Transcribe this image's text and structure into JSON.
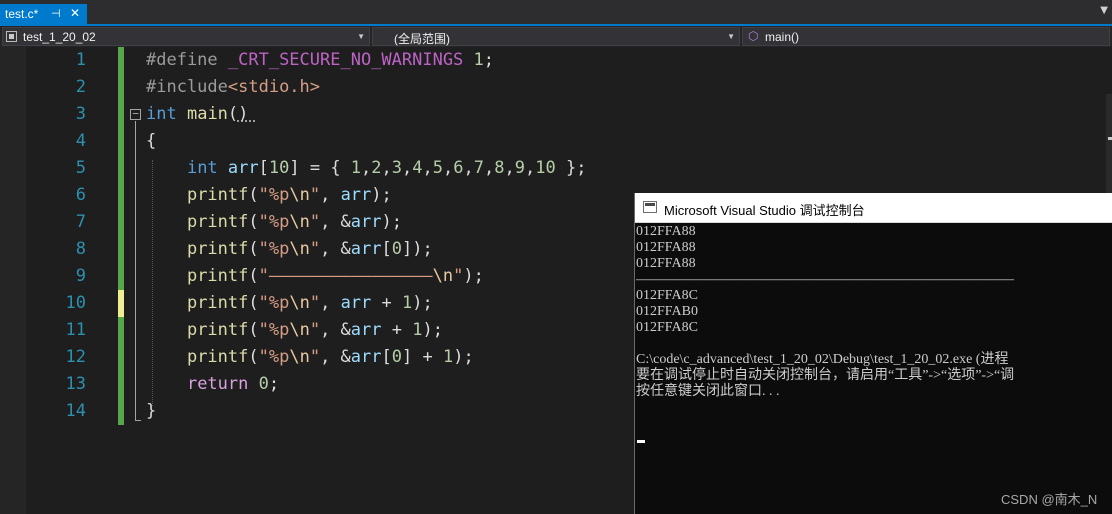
{
  "tab": {
    "title": "test.c*",
    "pin_icon": "⊣",
    "close_icon": "✕"
  },
  "navbar": {
    "project": "test_1_20_02",
    "scope": "(全局范围)",
    "function": "main()"
  },
  "editor": {
    "lines": [
      {
        "number": "1",
        "tokens": [
          {
            "t": "#define ",
            "c": "t-pre"
          },
          {
            "t": "_CRT_SECURE_NO_WARNINGS",
            "c": "t-macro"
          },
          {
            "t": " ",
            "c": "t-plain"
          },
          {
            "t": "1",
            "c": "t-num"
          },
          {
            "t": ";",
            "c": "t-plain"
          }
        ]
      },
      {
        "number": "2",
        "tokens": [
          {
            "t": "#include",
            "c": "t-pre"
          },
          {
            "t": "<stdio.h>",
            "c": "t-str"
          }
        ]
      },
      {
        "number": "3",
        "tokens": [
          {
            "t": "int",
            "c": "t-kw"
          },
          {
            "t": " ",
            "c": "t-plain"
          },
          {
            "t": "main",
            "c": "t-fn"
          },
          {
            "t": "()",
            "c": "t-plain"
          }
        ]
      },
      {
        "number": "4",
        "tokens": [
          {
            "t": "{",
            "c": "t-plain"
          }
        ]
      },
      {
        "number": "5",
        "tokens": [
          {
            "t": "    ",
            "c": "t-plain"
          },
          {
            "t": "int",
            "c": "t-kw"
          },
          {
            "t": " ",
            "c": "t-plain"
          },
          {
            "t": "arr",
            "c": "t-var"
          },
          {
            "t": "[",
            "c": "t-plain"
          },
          {
            "t": "10",
            "c": "t-num"
          },
          {
            "t": "] = { ",
            "c": "t-plain"
          },
          {
            "t": "1",
            "c": "t-num"
          },
          {
            "t": ",",
            "c": "t-plain"
          },
          {
            "t": "2",
            "c": "t-num"
          },
          {
            "t": ",",
            "c": "t-plain"
          },
          {
            "t": "3",
            "c": "t-num"
          },
          {
            "t": ",",
            "c": "t-plain"
          },
          {
            "t": "4",
            "c": "t-num"
          },
          {
            "t": ",",
            "c": "t-plain"
          },
          {
            "t": "5",
            "c": "t-num"
          },
          {
            "t": ",",
            "c": "t-plain"
          },
          {
            "t": "6",
            "c": "t-num"
          },
          {
            "t": ",",
            "c": "t-plain"
          },
          {
            "t": "7",
            "c": "t-num"
          },
          {
            "t": ",",
            "c": "t-plain"
          },
          {
            "t": "8",
            "c": "t-num"
          },
          {
            "t": ",",
            "c": "t-plain"
          },
          {
            "t": "9",
            "c": "t-num"
          },
          {
            "t": ",",
            "c": "t-plain"
          },
          {
            "t": "10",
            "c": "t-num"
          },
          {
            "t": " };",
            "c": "t-plain"
          }
        ]
      },
      {
        "number": "6",
        "tokens": [
          {
            "t": "    ",
            "c": "t-plain"
          },
          {
            "t": "printf",
            "c": "t-fn"
          },
          {
            "t": "(",
            "c": "t-plain"
          },
          {
            "t": "\"%p",
            "c": "t-str"
          },
          {
            "t": "\\n",
            "c": "t-esc"
          },
          {
            "t": "\"",
            "c": "t-str"
          },
          {
            "t": ", ",
            "c": "t-plain"
          },
          {
            "t": "arr",
            "c": "t-var"
          },
          {
            "t": ");",
            "c": "t-plain"
          }
        ]
      },
      {
        "number": "7",
        "tokens": [
          {
            "t": "    ",
            "c": "t-plain"
          },
          {
            "t": "printf",
            "c": "t-fn"
          },
          {
            "t": "(",
            "c": "t-plain"
          },
          {
            "t": "\"%p",
            "c": "t-str"
          },
          {
            "t": "\\n",
            "c": "t-esc"
          },
          {
            "t": "\"",
            "c": "t-str"
          },
          {
            "t": ", &",
            "c": "t-plain"
          },
          {
            "t": "arr",
            "c": "t-var"
          },
          {
            "t": ");",
            "c": "t-plain"
          }
        ]
      },
      {
        "number": "8",
        "tokens": [
          {
            "t": "    ",
            "c": "t-plain"
          },
          {
            "t": "printf",
            "c": "t-fn"
          },
          {
            "t": "(",
            "c": "t-plain"
          },
          {
            "t": "\"%p",
            "c": "t-str"
          },
          {
            "t": "\\n",
            "c": "t-esc"
          },
          {
            "t": "\"",
            "c": "t-str"
          },
          {
            "t": ", &",
            "c": "t-plain"
          },
          {
            "t": "arr",
            "c": "t-var"
          },
          {
            "t": "[",
            "c": "t-plain"
          },
          {
            "t": "0",
            "c": "t-num"
          },
          {
            "t": "]);",
            "c": "t-plain"
          }
        ]
      },
      {
        "number": "9",
        "tokens": [
          {
            "t": "    ",
            "c": "t-plain"
          },
          {
            "t": "printf",
            "c": "t-fn"
          },
          {
            "t": "(",
            "c": "t-plain"
          },
          {
            "t": "\"————————————————",
            "c": "t-str"
          },
          {
            "t": "\\n",
            "c": "t-esc"
          },
          {
            "t": "\"",
            "c": "t-str"
          },
          {
            "t": ");",
            "c": "t-plain"
          }
        ]
      },
      {
        "number": "10",
        "tokens": [
          {
            "t": "    ",
            "c": "t-plain"
          },
          {
            "t": "printf",
            "c": "t-fn"
          },
          {
            "t": "(",
            "c": "t-plain"
          },
          {
            "t": "\"%p",
            "c": "t-str"
          },
          {
            "t": "\\n",
            "c": "t-esc"
          },
          {
            "t": "\"",
            "c": "t-str"
          },
          {
            "t": ", ",
            "c": "t-plain"
          },
          {
            "t": "arr",
            "c": "t-var"
          },
          {
            "t": " + ",
            "c": "t-plain"
          },
          {
            "t": "1",
            "c": "t-num"
          },
          {
            "t": ");",
            "c": "t-plain"
          }
        ]
      },
      {
        "number": "11",
        "tokens": [
          {
            "t": "    ",
            "c": "t-plain"
          },
          {
            "t": "printf",
            "c": "t-fn"
          },
          {
            "t": "(",
            "c": "t-plain"
          },
          {
            "t": "\"%p",
            "c": "t-str"
          },
          {
            "t": "\\n",
            "c": "t-esc"
          },
          {
            "t": "\"",
            "c": "t-str"
          },
          {
            "t": ", &",
            "c": "t-plain"
          },
          {
            "t": "arr",
            "c": "t-var"
          },
          {
            "t": " + ",
            "c": "t-plain"
          },
          {
            "t": "1",
            "c": "t-num"
          },
          {
            "t": ");",
            "c": "t-plain"
          }
        ]
      },
      {
        "number": "12",
        "tokens": [
          {
            "t": "    ",
            "c": "t-plain"
          },
          {
            "t": "printf",
            "c": "t-fn"
          },
          {
            "t": "(",
            "c": "t-plain"
          },
          {
            "t": "\"%p",
            "c": "t-str"
          },
          {
            "t": "\\n",
            "c": "t-esc"
          },
          {
            "t": "\"",
            "c": "t-str"
          },
          {
            "t": ", &",
            "c": "t-plain"
          },
          {
            "t": "arr",
            "c": "t-var"
          },
          {
            "t": "[",
            "c": "t-plain"
          },
          {
            "t": "0",
            "c": "t-num"
          },
          {
            "t": "] + ",
            "c": "t-plain"
          },
          {
            "t": "1",
            "c": "t-num"
          },
          {
            "t": ");",
            "c": "t-plain"
          }
        ]
      },
      {
        "number": "13",
        "tokens": [
          {
            "t": "    ",
            "c": "t-plain"
          },
          {
            "t": "return",
            "c": "t-ctl"
          },
          {
            "t": " ",
            "c": "t-plain"
          },
          {
            "t": "0",
            "c": "t-num"
          },
          {
            "t": ";",
            "c": "t-plain"
          }
        ]
      },
      {
        "number": "14",
        "tokens": [
          {
            "t": "}",
            "c": "t-plain"
          }
        ]
      }
    ]
  },
  "console": {
    "title": "Microsoft Visual Studio 调试控制台",
    "lines": [
      "012FFA88",
      "012FFA88",
      "012FFA88",
      "———————————————————————————",
      "012FFA8C",
      "012FFAB0",
      "012FFA8C",
      "",
      "C:\\code\\c_advanced\\test_1_20_02\\Debug\\test_1_20_02.exe (进程",
      "要在调试停止时自动关闭控制台，请启用“工具”->“选项”->“调",
      "按任意键关闭此窗口. . ."
    ]
  },
  "watermark": "CSDN @南木_N"
}
